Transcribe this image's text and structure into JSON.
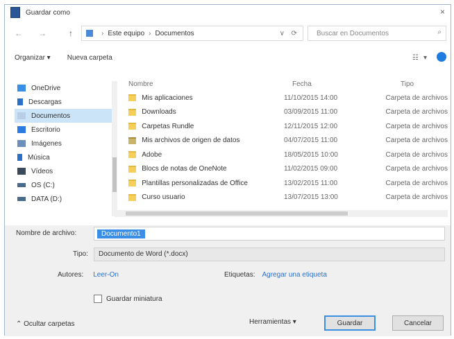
{
  "window": {
    "title": "Guardar como",
    "close_label": "×"
  },
  "address": {
    "back": "←",
    "forward": "→",
    "up": "↑",
    "path": [
      "Este equipo",
      "Documentos"
    ],
    "separator": "›",
    "dropdown": "∨",
    "refresh": "⟳",
    "search_placeholder": "Buscar en Documentos",
    "search_icon": "⌕"
  },
  "toolbar": {
    "organize": "Organizar ▾",
    "new_folder": "Nueva carpeta",
    "view": "☷",
    "view_drop": "▾"
  },
  "nav": {
    "items": [
      {
        "label": "OneDrive",
        "color": "#3a8ee6",
        "selected": false
      },
      {
        "label": "Descargas",
        "color": "#2a6fc9",
        "selected": false
      },
      {
        "label": "Documentos",
        "color": "#b8cde6",
        "selected": true
      },
      {
        "label": "Escritorio",
        "color": "#2b7be0",
        "selected": false
      },
      {
        "label": "Imágenes",
        "color": "#6a8fb8",
        "selected": false
      },
      {
        "label": "Música",
        "color": "#2a6fc9",
        "selected": false
      },
      {
        "label": "Vídeos",
        "color": "#3a4a5a",
        "selected": false
      },
      {
        "label": "OS (C:)",
        "color": "#4a6a8a",
        "selected": false
      },
      {
        "label": "DATA (D:)",
        "color": "#4a6a8a",
        "selected": false
      }
    ]
  },
  "files": {
    "headers": {
      "name": "Nombre",
      "date": "Fecha",
      "type": "Tipo"
    },
    "rows": [
      {
        "name": "Mis aplicaciones",
        "date": "11/10/2015 14:00",
        "type": "Carpeta de archivos",
        "lib": false
      },
      {
        "name": "Downloads",
        "date": "03/09/2015 11:00",
        "type": "Carpeta de archivos",
        "lib": false
      },
      {
        "name": "Carpetas Rundle",
        "date": "12/11/2015 12:00",
        "type": "Carpeta de archivos",
        "lib": false
      },
      {
        "name": "Mis archivos de origen de datos",
        "date": "04/07/2015 11:00",
        "type": "Carpeta de archivos",
        "lib": true
      },
      {
        "name": "Adobe",
        "date": "18/05/2015 10:00",
        "type": "Carpeta de archivos",
        "lib": false
      },
      {
        "name": "Blocs de notas de OneNote",
        "date": "11/02/2015 09:00",
        "type": "Carpeta de archivos",
        "lib": false
      },
      {
        "name": "Plantillas personalizadas de Office",
        "date": "13/02/2015 11:00",
        "type": "Carpeta de archivos",
        "lib": false
      },
      {
        "name": "Curso usuario",
        "date": "13/07/2015 13:00",
        "type": "Carpeta de archivos",
        "lib": false
      }
    ]
  },
  "form": {
    "filename_label": "Nombre de archivo:",
    "filename_value": "Documento1",
    "type_label": "Tipo:",
    "type_value": "Documento de Word (*.docx)",
    "authors_label": "Autores:",
    "authors_value": "Leer-On",
    "tags_label": "Etiquetas:",
    "tags_value": "Agregar una etiqueta",
    "thumbnail_label": "Guardar miniatura"
  },
  "bottom": {
    "hide_folders": "⌃ Ocultar carpetas",
    "tools": "Herramientas ▾",
    "save": "Guardar",
    "cancel": "Cancelar"
  }
}
